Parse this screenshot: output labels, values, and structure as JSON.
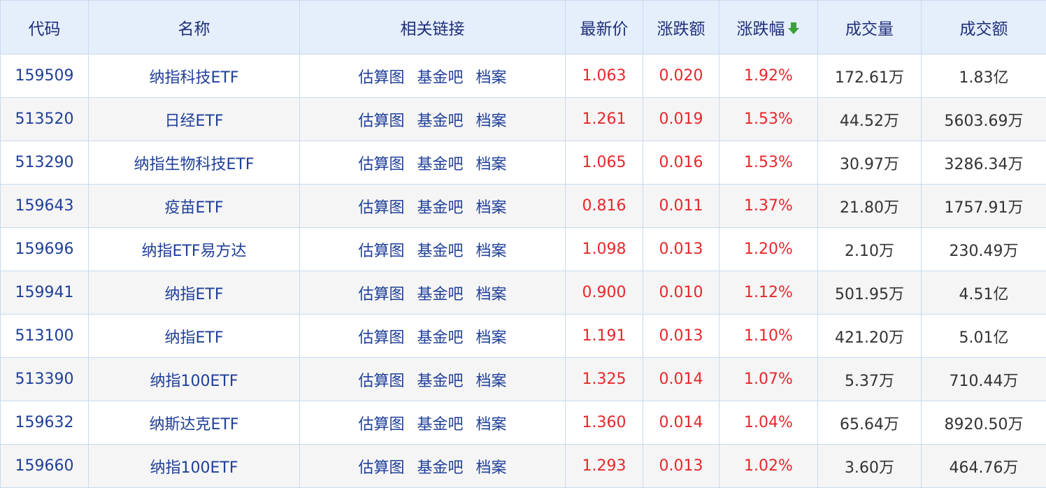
{
  "headers": {
    "code": "代码",
    "name": "名称",
    "links": "相关链接",
    "price": "最新价",
    "change": "涨跌额",
    "pct": "涨跌幅",
    "volume": "成交量",
    "amount": "成交额"
  },
  "sort": {
    "column": "pct",
    "direction": "desc",
    "icon": "arrow-down-icon",
    "color": "#3ca03c"
  },
  "colors": {
    "up": "#e8272b",
    "link": "#1f3f99",
    "header_bg": "#e5eefb"
  },
  "link_labels": [
    "估算图",
    "基金吧",
    "档案"
  ],
  "rows": [
    {
      "code": "159509",
      "name": "纳指科技ETF",
      "price": "1.063",
      "change": "0.020",
      "pct": "1.92%",
      "volume": "172.61万",
      "amount": "1.83亿"
    },
    {
      "code": "513520",
      "name": "日经ETF",
      "price": "1.261",
      "change": "0.019",
      "pct": "1.53%",
      "volume": "44.52万",
      "amount": "5603.69万"
    },
    {
      "code": "513290",
      "name": "纳指生物科技ETF",
      "price": "1.065",
      "change": "0.016",
      "pct": "1.53%",
      "volume": "30.97万",
      "amount": "3286.34万"
    },
    {
      "code": "159643",
      "name": "疫苗ETF",
      "price": "0.816",
      "change": "0.011",
      "pct": "1.37%",
      "volume": "21.80万",
      "amount": "1757.91万"
    },
    {
      "code": "159696",
      "name": "纳指ETF易方达",
      "price": "1.098",
      "change": "0.013",
      "pct": "1.20%",
      "volume": "2.10万",
      "amount": "230.49万"
    },
    {
      "code": "159941",
      "name": "纳指ETF",
      "price": "0.900",
      "change": "0.010",
      "pct": "1.12%",
      "volume": "501.95万",
      "amount": "4.51亿"
    },
    {
      "code": "513100",
      "name": "纳指ETF",
      "price": "1.191",
      "change": "0.013",
      "pct": "1.10%",
      "volume": "421.20万",
      "amount": "5.01亿"
    },
    {
      "code": "513390",
      "name": "纳指100ETF",
      "price": "1.325",
      "change": "0.014",
      "pct": "1.07%",
      "volume": "5.37万",
      "amount": "710.44万"
    },
    {
      "code": "159632",
      "name": "纳斯达克ETF",
      "price": "1.360",
      "change": "0.014",
      "pct": "1.04%",
      "volume": "65.64万",
      "amount": "8920.50万"
    },
    {
      "code": "159660",
      "name": "纳指100ETF",
      "price": "1.293",
      "change": "0.013",
      "pct": "1.02%",
      "volume": "3.60万",
      "amount": "464.76万"
    }
  ]
}
